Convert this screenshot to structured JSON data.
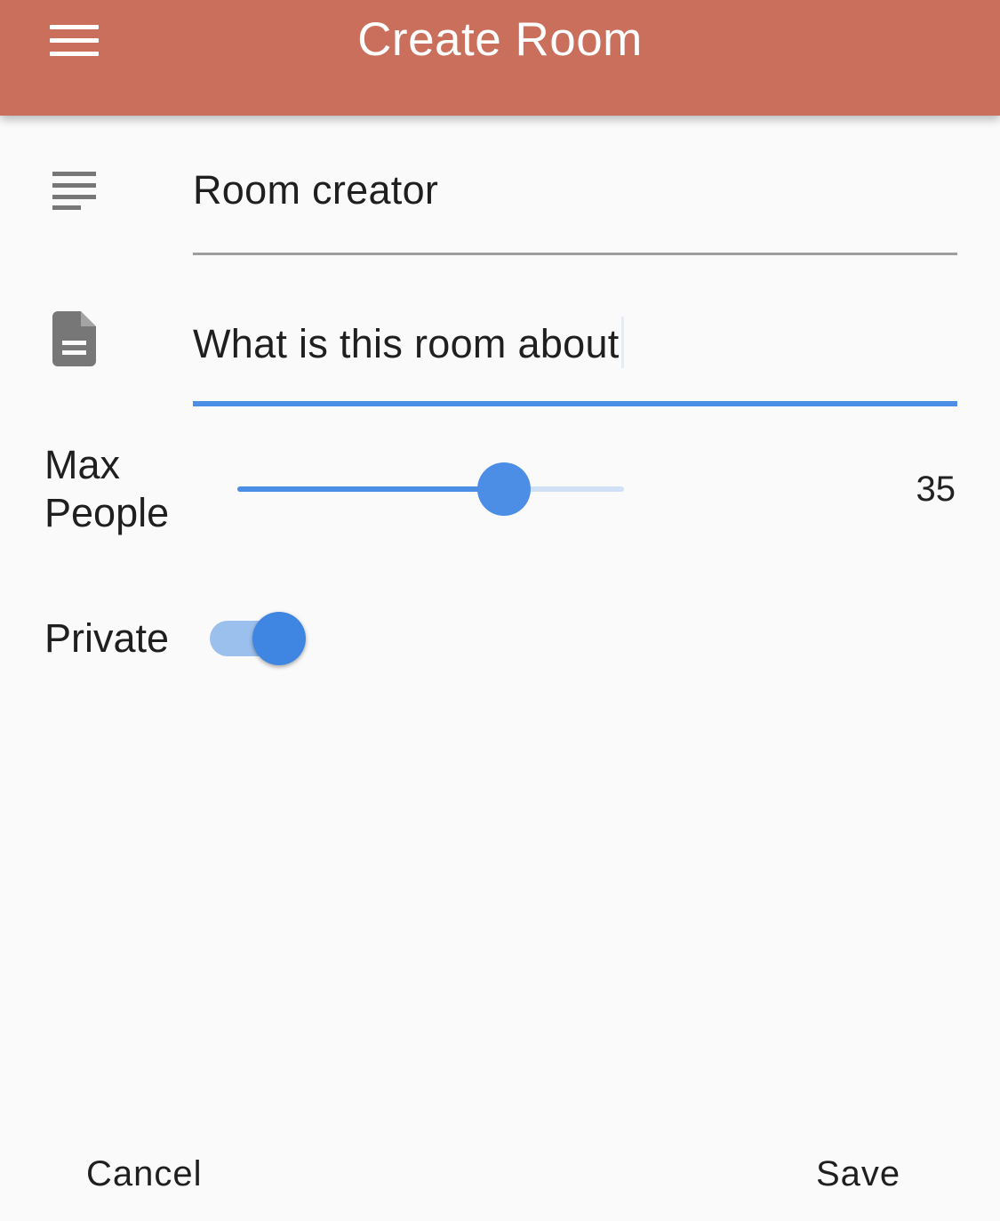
{
  "app_bar": {
    "title": "Create Room",
    "menu_icon": "menu-icon",
    "color": "#c96f5b"
  },
  "form": {
    "room_name": {
      "value": "Room creator",
      "icon": "subject-icon"
    },
    "description": {
      "value": "What is this room about",
      "icon": "description-icon",
      "focused": true
    },
    "max_people": {
      "label": "Max People",
      "label_line1": "Max",
      "label_line2": "People",
      "value": "35",
      "fraction": 0.69
    },
    "private": {
      "label": "Private",
      "on": true
    }
  },
  "actions": {
    "cancel_label": "Cancel",
    "save_label": "Save"
  },
  "colors": {
    "accent": "#4c8ee6",
    "underline": "#9e9e9e",
    "background": "#fafafa"
  }
}
